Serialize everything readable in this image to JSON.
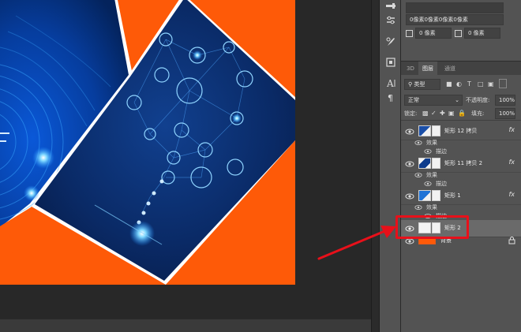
{
  "properties": {
    "row1": "0像素0像素0像素0像素",
    "row2_a": "0 像素",
    "row2_b": "0 像素"
  },
  "tabs": [
    {
      "label": "3D",
      "active": false
    },
    {
      "label": "图层",
      "active": true
    },
    {
      "label": "通道",
      "active": false
    }
  ],
  "layers_panel": {
    "filter_kind": "类型",
    "blend_mode": "正常",
    "opacity_label": "不透明度:",
    "opacity_value": "100%",
    "lock_label": "锁定:",
    "fill_label": "填充:",
    "fill_value": "100%"
  },
  "layers": [
    {
      "name": "矩形 12 拷贝",
      "fx": "fx",
      "effects_label": "效果",
      "effect": "描边"
    },
    {
      "name": "矩形 11 拷贝 2",
      "fx": "fx",
      "effects_label": "效果",
      "effect": "描边"
    },
    {
      "name": "矩形 1",
      "fx": "fx",
      "effects_label": "效果",
      "effect": "描边"
    },
    {
      "name": "矩形 2",
      "selected": true
    },
    {
      "name": "背景",
      "locked": true
    }
  ],
  "colors": {
    "canvas_orange": "#fe5a08",
    "highlight_red": "#e8101a",
    "panel_gray": "#535353"
  },
  "icons": [
    "eye-icon",
    "lock-icon",
    "fx-icon",
    "search-icon",
    "text-tool-icon",
    "paragraph-icon"
  ]
}
